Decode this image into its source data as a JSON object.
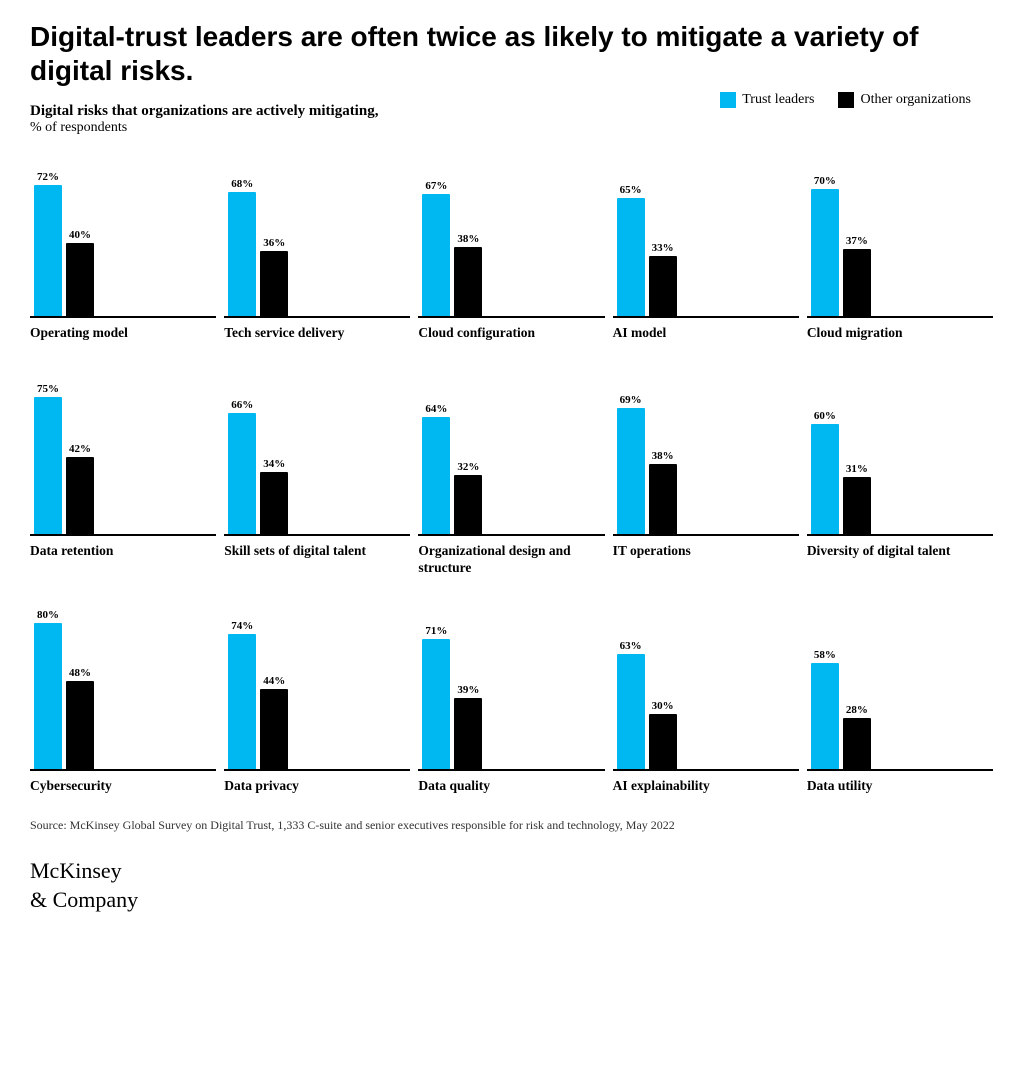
{
  "title": "Digital-trust leaders are often twice as likely to mitigate a variety of digital risks.",
  "subtitle_main": "Digital risks that organizations are actively mitigating,",
  "subtitle_sub": "% of respondents",
  "legend": {
    "trust_leaders_label": "Trust leaders",
    "trust_leaders_color": "#00b8f1",
    "other_orgs_label": "Other organizations",
    "other_orgs_color": "#000000"
  },
  "source": "Source: McKinsey Global Survey on Digital Trust, 1,333 C-suite and senior executives responsible for risk and technology, May 2022",
  "logo_line1": "McKinsey",
  "logo_line2": "& Company",
  "rows": [
    {
      "items": [
        {
          "label": "Operating model",
          "trust": 72,
          "other": 40
        },
        {
          "label": "Tech service delivery",
          "trust": 68,
          "other": 36
        },
        {
          "label": "Cloud configuration",
          "trust": 67,
          "other": 38
        },
        {
          "label": "AI model",
          "trust": 65,
          "other": 33
        },
        {
          "label": "Cloud migration",
          "trust": 70,
          "other": 37
        }
      ]
    },
    {
      "items": [
        {
          "label": "Data retention",
          "trust": 75,
          "other": 42
        },
        {
          "label": "Skill sets of digital talent",
          "trust": 66,
          "other": 34
        },
        {
          "label": "Organizational design and structure",
          "trust": 64,
          "other": 32
        },
        {
          "label": "IT operations",
          "trust": 69,
          "other": 38
        },
        {
          "label": "Diversity of digital talent",
          "trust": 60,
          "other": 31
        }
      ]
    },
    {
      "items": [
        {
          "label": "Cybersecurity",
          "trust": 80,
          "other": 48
        },
        {
          "label": "Data privacy",
          "trust": 74,
          "other": 44
        },
        {
          "label": "Data quality",
          "trust": 71,
          "other": 39
        },
        {
          "label": "AI explainability",
          "trust": 63,
          "other": 30
        },
        {
          "label": "Data utility",
          "trust": 58,
          "other": 28
        }
      ]
    }
  ]
}
